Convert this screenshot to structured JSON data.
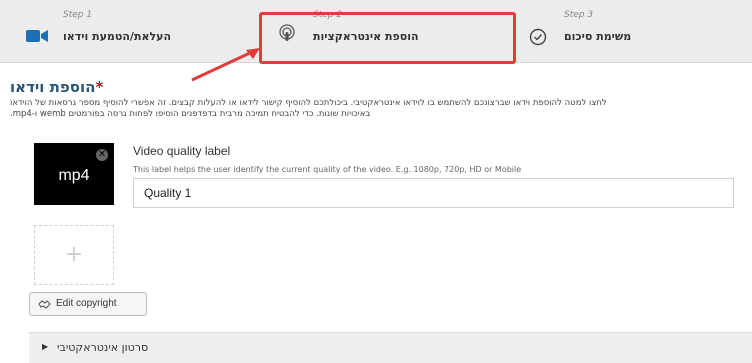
{
  "steps": [
    {
      "small": "Step 1",
      "title": "העלאת/הטמעת וידאו",
      "icon": "video-camera-icon"
    },
    {
      "small": "Step 2",
      "title": "הוספת אינטראקציות",
      "icon": "touch-icon"
    },
    {
      "small": "Step 3",
      "title": "משימת סיכום",
      "icon": "check-circle-icon"
    }
  ],
  "section": {
    "title": "הוספת וידאו",
    "required_mark": "*",
    "description_line1": "לחצו למטה להוספת וידאו שברצונכם להשתמש בו לוידאו אינטראקטיבי. ביכולתכם להוסיף קישור לידאו או להעלות קבצים. זה אפשרי להוסיף מספר גרסאות של הוידאו",
    "description_line2": "באיכויות שונות. כדי להבטיח תמיכה מרבית בדפדפנים הוסיפו לפחות גרסה בפורמטים wemb ו-mp4."
  },
  "video_item": {
    "format": "mp4",
    "remove_glyph": "✕",
    "quality_label": "Video quality label",
    "quality_help": "This label helps the user identify the current quality of the video. E.g. 1080p, 720p, HD or Mobile",
    "quality_value": "Quality 1"
  },
  "add_button": {
    "glyph": "+"
  },
  "copyright": {
    "label": "Edit copyright",
    "icon": "handshake-icon"
  },
  "interactive_video": {
    "label": "סרטון אינטראקטיבי",
    "chevron": "▶"
  },
  "colors": {
    "highlight": "#e23b3b",
    "heading": "#2a5575",
    "required": "#d0021b",
    "video_icon": "#1a6fb5"
  }
}
